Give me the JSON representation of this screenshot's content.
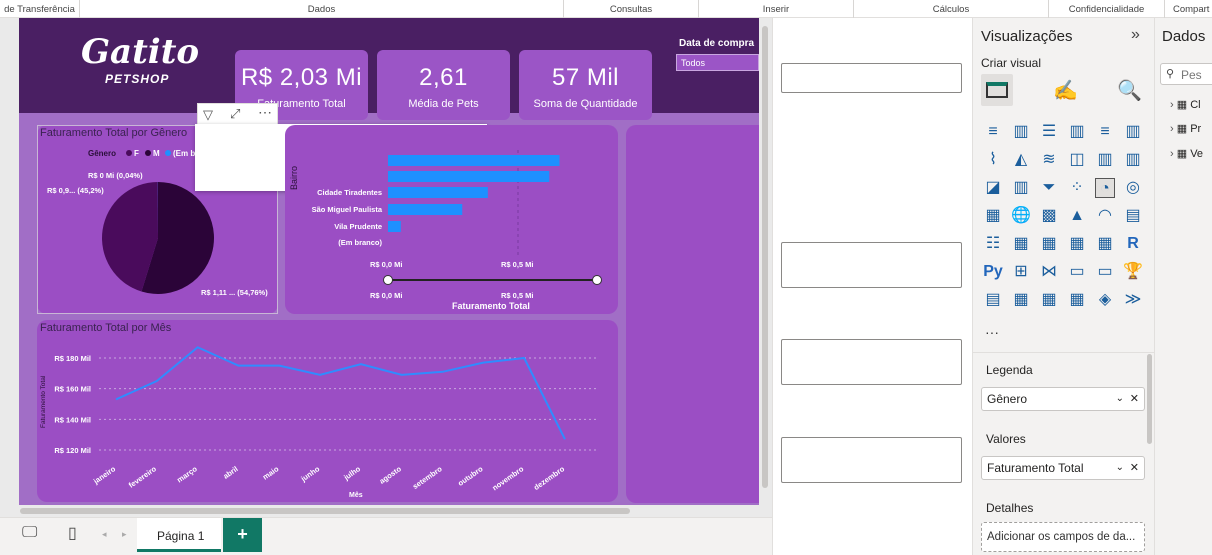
{
  "ribbon": {
    "groups": [
      "de Transferência",
      "Dados",
      "Consultas",
      "Inserir",
      "Cálculos",
      "Confidencialidade",
      "Compart"
    ]
  },
  "report": {
    "logo_main": "Gatito",
    "logo_sub": "PETSHOP",
    "kpis": [
      {
        "value": "R$ 2,03 Mi",
        "label": "Faturamento Total"
      },
      {
        "value": "2,61",
        "label": "Média de Pets"
      },
      {
        "value": "57 Mil",
        "label": "Soma de Quantidade"
      }
    ],
    "slicer": {
      "title": "Data de compra",
      "value": "Todos"
    }
  },
  "pie_card": {
    "title": "Faturamento Total por Gênero",
    "legend_title": "Gênero",
    "legend_items": [
      "F",
      "M",
      "(Em b"
    ],
    "labels": [
      "R$ 0 Mi (0,04%)",
      "R$ 0,9... (45,2%)",
      "R$ 1,11 ... (54,76%)"
    ]
  },
  "bar_card": {
    "yaxis_label": "Bairro",
    "xaxis_title": "Faturamento Total",
    "ticks": [
      "R$ 0,0 Mi",
      "R$ 0,5 Mi"
    ],
    "slider_ticks": [
      "R$ 0,0 Mi",
      "R$ 0,5 Mi"
    ]
  },
  "line_card": {
    "title": "Faturamento Total por Mês",
    "ylabel": "Faturamento Total",
    "xlabel": "Mês"
  },
  "chart_data": [
    {
      "type": "pie",
      "title": "Faturamento Total por Gênero",
      "legend_title": "Gênero",
      "slices": [
        {
          "name": "F",
          "value": 0.9,
          "percent": 45.2,
          "color": "#4a0b5c"
        },
        {
          "name": "M",
          "value": 1.11,
          "percent": 54.76,
          "color": "#2b0438"
        },
        {
          "name": "(Em b",
          "value": 0.0,
          "percent": 0.04,
          "color": "#1e90ff"
        }
      ]
    },
    {
      "type": "bar",
      "orientation": "horizontal",
      "xlabel": "Faturamento Total",
      "ylabel": "Bairro",
      "categories": [
        "",
        "",
        "Cidade Tiradentes",
        "São Miguel Paulista",
        "Vila Prudente",
        "(Em branco)"
      ],
      "values": [
        0.67,
        0.63,
        0.39,
        0.29,
        0.05,
        0
      ],
      "xlim": [
        0,
        0.75
      ],
      "color": "#1e90ff"
    },
    {
      "type": "line",
      "title": "Faturamento Total por Mês",
      "xlabel": "Mês",
      "ylabel": "Faturamento Total",
      "categories": [
        "janeiro",
        "fevereiro",
        "março",
        "abril",
        "maio",
        "junho",
        "julho",
        "agosto",
        "setembro",
        "outubro",
        "novembro",
        "dezembro"
      ],
      "yticks": [
        "R$ 120 Mil",
        "R$ 140 Mil",
        "R$ 160 Mil",
        "R$ 180 Mil"
      ],
      "ylim": [
        120,
        190
      ],
      "series": [
        {
          "values": [
            153,
            165,
            187,
            175,
            175,
            169,
            176,
            169,
            171,
            177,
            180,
            127
          ],
          "color": "#2f8cff"
        }
      ]
    }
  ],
  "tabs": {
    "page": "Página 1",
    "add": "+"
  },
  "viz": {
    "title": "Visualizações",
    "subtitle": "Criar visual",
    "more": "···",
    "well_labels": [
      "Legenda",
      "Valores",
      "Detalhes"
    ],
    "well_values": [
      "Gênero",
      "Faturamento Total"
    ],
    "details_placeholder": "Adicionar os campos de da..."
  },
  "dados": {
    "title": "Dados",
    "search_placeholder": "Pes",
    "tables": [
      "Cl",
      "Pr",
      "Ve"
    ]
  }
}
